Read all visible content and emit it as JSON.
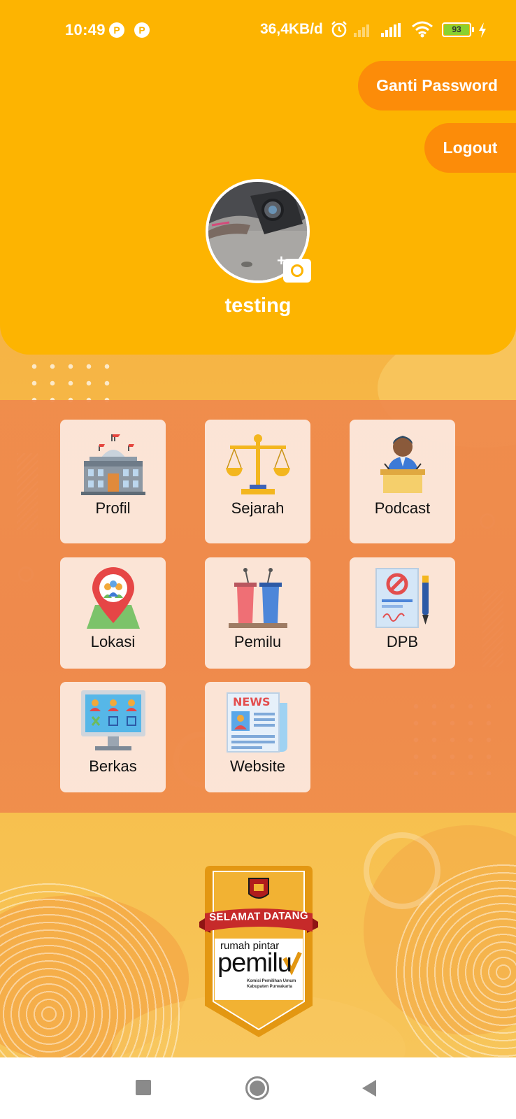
{
  "status_bar": {
    "time": "10:49",
    "net_speed": "36,4KB/d",
    "battery": "93"
  },
  "header": {
    "ganti_password_label": "Ganti Password",
    "logout_label": "Logout",
    "username": "testing",
    "accent_color": "#fdb401",
    "button_color": "#fc8c09"
  },
  "menu": {
    "items": [
      {
        "label": "Profil",
        "icon": "government-building-icon"
      },
      {
        "label": "Sejarah",
        "icon": "scales-of-justice-icon"
      },
      {
        "label": "Podcast",
        "icon": "speaker-at-podium-icon"
      },
      {
        "label": "Lokasi",
        "icon": "map-pin-icon"
      },
      {
        "label": "Pemilu",
        "icon": "podiums-icon"
      },
      {
        "label": "DPB",
        "icon": "document-pen-icon"
      },
      {
        "label": "Berkas",
        "icon": "computer-monitor-icon"
      },
      {
        "label": "Website",
        "icon": "newspaper-icon"
      }
    ]
  },
  "welcome_badge": {
    "ribbon_text": "SELAMAT DATANG",
    "line1": "rumah pintar",
    "line2": "pemilu",
    "sub1": "Komisi Pemilihan Umum",
    "sub2": "Kabupaten Purwakarta"
  }
}
